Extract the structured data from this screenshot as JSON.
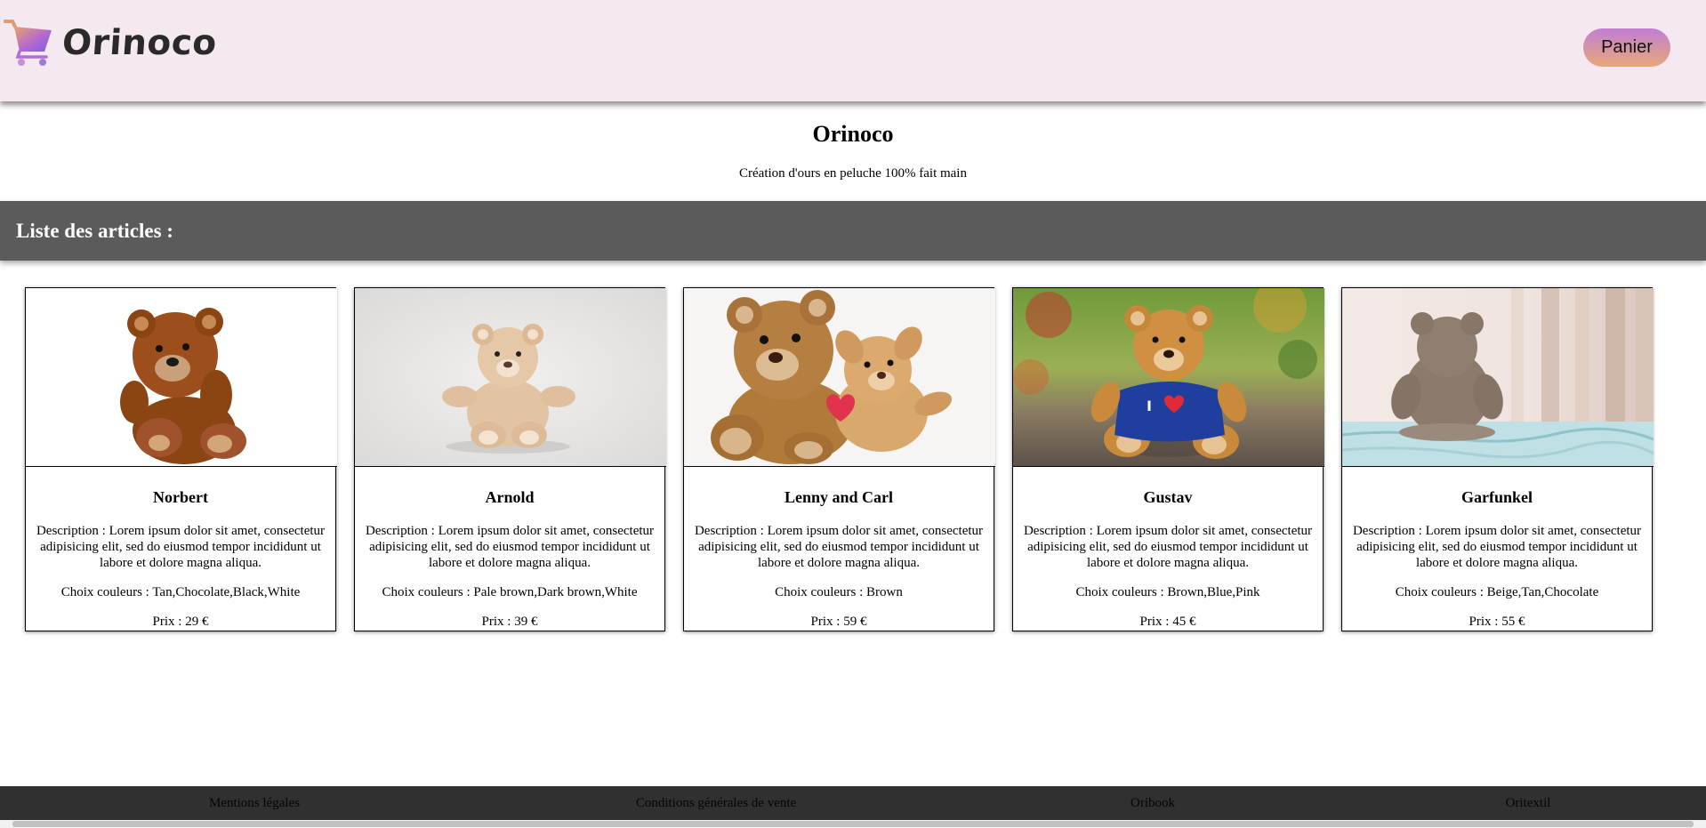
{
  "header": {
    "logo_text": "Orinoco",
    "cart_label": "Panier"
  },
  "hero": {
    "title": "Orinoco",
    "subtitle": "Création d'ours en peluche 100% fait main"
  },
  "section": {
    "title": "Liste des articles :"
  },
  "products": [
    {
      "name": "Norbert",
      "description": "Description : Lorem ipsum dolor sit amet, consectetur adipisicing elit, sed do eiusmod tempor incididunt ut labore et dolore magna aliqua.",
      "colors": "Choix couleurs : Tan,Chocolate,Black,White",
      "price": "Prix : 29 €"
    },
    {
      "name": "Arnold",
      "description": "Description : Lorem ipsum dolor sit amet, consectetur adipisicing elit, sed do eiusmod tempor incididunt ut labore et dolore magna aliqua.",
      "colors": "Choix couleurs : Pale brown,Dark brown,White",
      "price": "Prix : 39 €"
    },
    {
      "name": "Lenny and Carl",
      "description": "Description : Lorem ipsum dolor sit amet, consectetur adipisicing elit, sed do eiusmod tempor incididunt ut labore et dolore magna aliqua.",
      "colors": "Choix couleurs : Brown",
      "price": "Prix : 59 €"
    },
    {
      "name": "Gustav",
      "description": "Description : Lorem ipsum dolor sit amet, consectetur adipisicing elit, sed do eiusmod tempor incididunt ut labore et dolore magna aliqua.",
      "colors": "Choix couleurs : Brown,Blue,Pink",
      "price": "Prix : 45 €"
    },
    {
      "name": "Garfunkel",
      "description": "Description : Lorem ipsum dolor sit amet, consectetur adipisicing elit, sed do eiusmod tempor incididunt ut labore et dolore magna aliqua.",
      "colors": "Choix couleurs : Beige,Tan,Chocolate",
      "price": "Prix : 55 €"
    }
  ],
  "footer": {
    "links": [
      "Mentions légales",
      "Conditions générales de vente",
      "Oribook",
      "Oritextil"
    ]
  },
  "colors": {
    "header_bg": "#f4e8f1",
    "section_band": "#5b5b5b",
    "footer_bg": "#303030",
    "cart_gradient_top": "#c27dd4",
    "cart_gradient_bottom": "#e7a878"
  }
}
